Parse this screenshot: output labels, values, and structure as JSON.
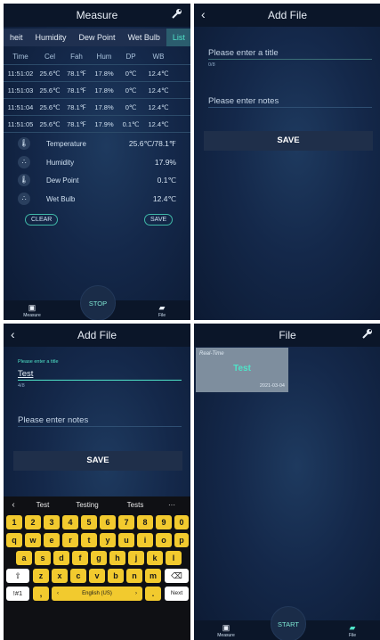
{
  "panel1": {
    "title": "Measure",
    "tabs": [
      "heit",
      "Humidity",
      "Dew Point",
      "Wet Bulb",
      "List"
    ],
    "table": {
      "headers": [
        "Time",
        "Cel",
        "Fah",
        "Hum",
        "DP",
        "WB"
      ],
      "rows": [
        [
          "11:51:02",
          "25.6℃",
          "78.1℉",
          "17.8%",
          "0℃",
          "12.4℃"
        ],
        [
          "11:51:03",
          "25.6℃",
          "78.1℉",
          "17.8%",
          "0℃",
          "12.4℃"
        ],
        [
          "11:51:04",
          "25.6℃",
          "78.1℉",
          "17.8%",
          "0℃",
          "12.4℃"
        ],
        [
          "11:51:05",
          "25.6℃",
          "78.1℉",
          "17.9%",
          "0.1℃",
          "12.4℃"
        ]
      ]
    },
    "sensors": [
      {
        "label": "Temperature",
        "value": "25.6℃/78.1℉"
      },
      {
        "label": "Humidity",
        "value": "17.9%"
      },
      {
        "label": "Dew Point",
        "value": "0.1℃"
      },
      {
        "label": "Wet Bulb",
        "value": "12.4℃"
      }
    ],
    "clear_label": "CLEAR",
    "save_label": "SAVE",
    "stop_label": "STOP",
    "nav_measure": "Measure",
    "nav_file": "File"
  },
  "panel2": {
    "title": "Add File",
    "title_placeholder": "Please enter a title",
    "counter": "0/8",
    "notes_placeholder": "Please enter notes",
    "save_label": "SAVE"
  },
  "panel3": {
    "title": "Add File",
    "floating_label": "Please enter a title",
    "title_value": "Test",
    "counter": "4/8",
    "notes_placeholder": "Please enter notes",
    "save_label": "SAVE",
    "keyboard": {
      "suggestions": [
        "Test",
        "Testing",
        "Tests",
        "···"
      ],
      "row_digits": [
        "1",
        "2",
        "3",
        "4",
        "5",
        "6",
        "7",
        "8",
        "9",
        "0"
      ],
      "row_q": [
        "q",
        "w",
        "e",
        "r",
        "t",
        "y",
        "u",
        "i",
        "o",
        "p"
      ],
      "row_a": [
        "a",
        "s",
        "d",
        "f",
        "g",
        "h",
        "j",
        "k",
        "l"
      ],
      "row_z": [
        "z",
        "x",
        "c",
        "v",
        "b",
        "n",
        "m"
      ],
      "symbols_label": "!#1",
      "comma_label": ",",
      "space_label": "English (US)",
      "period_label": ".",
      "next_label": "Next"
    }
  },
  "panel4": {
    "title": "File",
    "card": {
      "tag": "Real-Time",
      "name": "Test",
      "date": "2021-03-04"
    },
    "start_label": "START",
    "nav_measure": "Measure",
    "nav_file": "File"
  },
  "colors": {
    "accent": "#4fe3c8",
    "keyboard_key": "#f2ca2e",
    "topbar": "#0b1629"
  }
}
